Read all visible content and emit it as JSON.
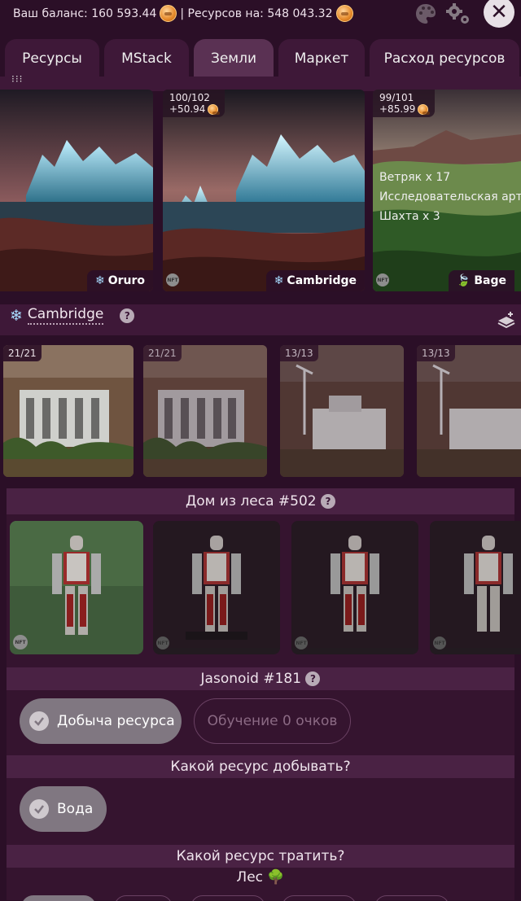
{
  "top": {
    "balance_label": "Ваш баланс: 160 593.44",
    "resources_label": "| Ресурсов на: 548 043.32"
  },
  "tabs": [
    {
      "label": "Ресурсы"
    },
    {
      "label": "MStack"
    },
    {
      "label": "Земли"
    },
    {
      "label": "Маркет"
    },
    {
      "label": "Расход ресурсов"
    }
  ],
  "lands": [
    {
      "name": "Oruro",
      "icon": "snowflake"
    },
    {
      "name": "Cambridge",
      "icon": "snowflake",
      "progress": "100/102",
      "income": "+50.94",
      "nft": "NFT"
    },
    {
      "name": "Bage",
      "icon": "leaf",
      "progress": "99/101",
      "income": "+85.99",
      "nft": "NFT",
      "info": [
        "Ветряк x 17",
        "Исследовательская артель",
        "Шахта x 3"
      ]
    }
  ],
  "selected_land": {
    "name": "Cambridge",
    "help": "?"
  },
  "buildings": [
    {
      "count": "21/21"
    },
    {
      "count": "21/21"
    },
    {
      "count": "13/13"
    },
    {
      "count": "13/13"
    }
  ],
  "house": {
    "title": "Дом из леса #502",
    "help": "?"
  },
  "robots": {
    "nft": "NFT"
  },
  "jasonoid": {
    "title": "Jasonoid #181",
    "help": "?"
  },
  "actions": {
    "mining": "Добыча ресурса",
    "training": "Обучение 0 очков"
  },
  "which_mine": {
    "title": "Какой ресурс добывать?",
    "option": "Вода"
  },
  "which_spend": {
    "title": "Какой ресурс тратить?",
    "resource": "Лес 🌳"
  },
  "colors": {
    "background": "#2b0f27",
    "bar": "#3e1838",
    "active_tab": "#5a3153",
    "pill": "#807781"
  }
}
